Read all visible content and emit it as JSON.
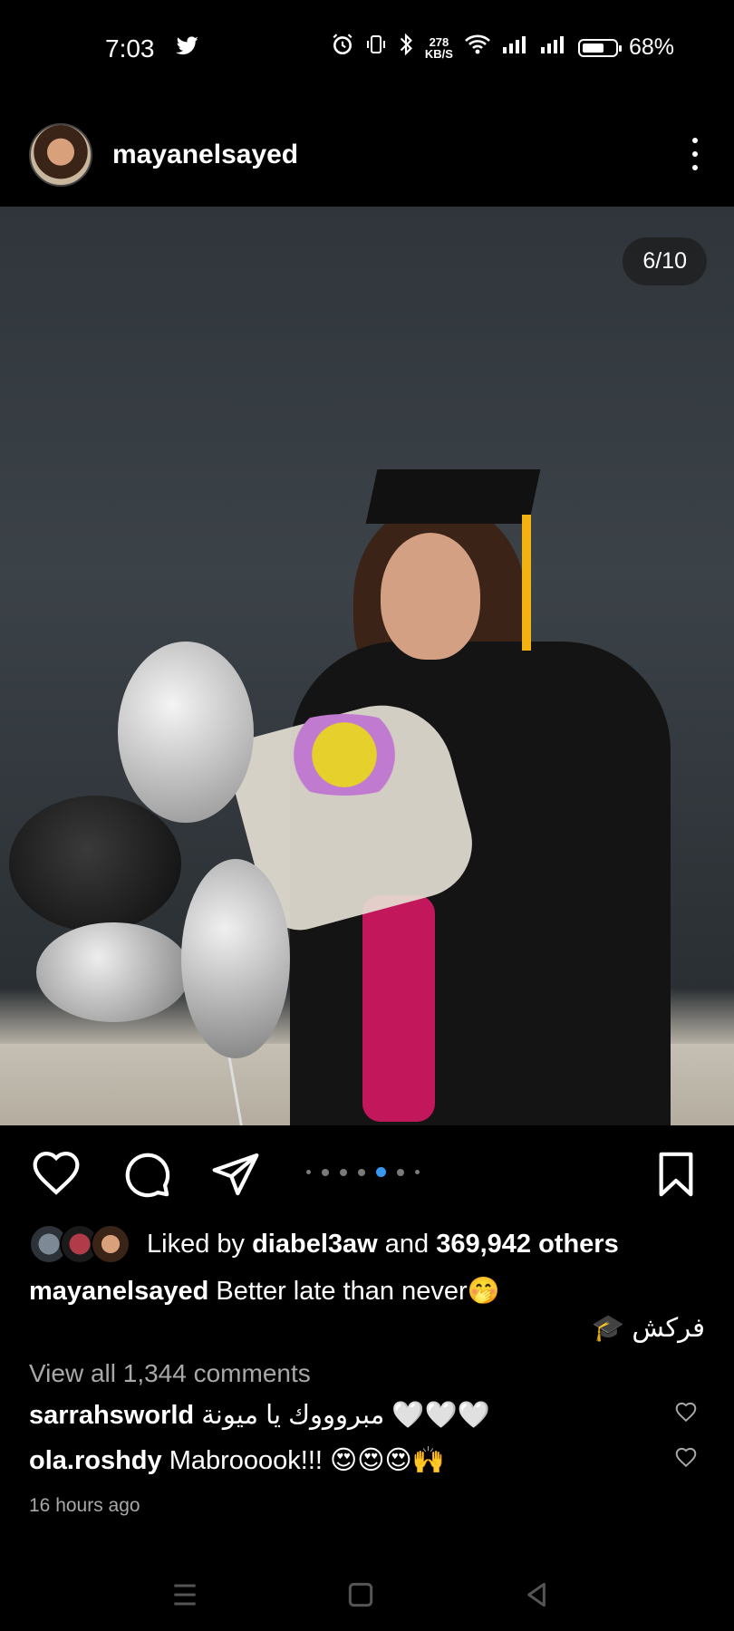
{
  "status_bar": {
    "time": "7:03",
    "network_speed_value": "278",
    "network_speed_unit": "KB/S",
    "battery_percent": "68%",
    "battery_level": 0.68
  },
  "post": {
    "username": "mayanelsayed",
    "photo_counter": "6/10",
    "carousel_total_dots": 7,
    "carousel_active_dot": 5,
    "likes": {
      "prefix": "Liked by ",
      "liker": "diabel3aw",
      "middle": " and ",
      "others": "369,942 others"
    },
    "caption": {
      "username": "mayanelsayed",
      "text": "Better late than never🤭",
      "second_line": "فركش 🎓"
    },
    "view_comments": "View all 1,344 comments",
    "comments": [
      {
        "username": "sarrahsworld",
        "text": "مبروووك يا ميونة 🤍🤍🤍"
      },
      {
        "username": "ola.roshdy",
        "text": "Mabrooook!!! 😍😍😍🙌"
      }
    ],
    "time_ago": "16 hours ago"
  },
  "colors": {
    "background": "#000000",
    "accent_blue": "#3897f0",
    "muted_text": "#a8a8a8"
  },
  "icons": {
    "status": [
      "twitter-icon",
      "alarm-icon",
      "vibrate-icon",
      "bluetooth-icon",
      "wifi-icon",
      "signal-icon",
      "battery-icon"
    ],
    "actions": [
      "heart-icon",
      "comment-icon",
      "share-icon",
      "bookmark-icon"
    ],
    "nav": [
      "menu-icon",
      "home-icon",
      "back-icon"
    ]
  }
}
